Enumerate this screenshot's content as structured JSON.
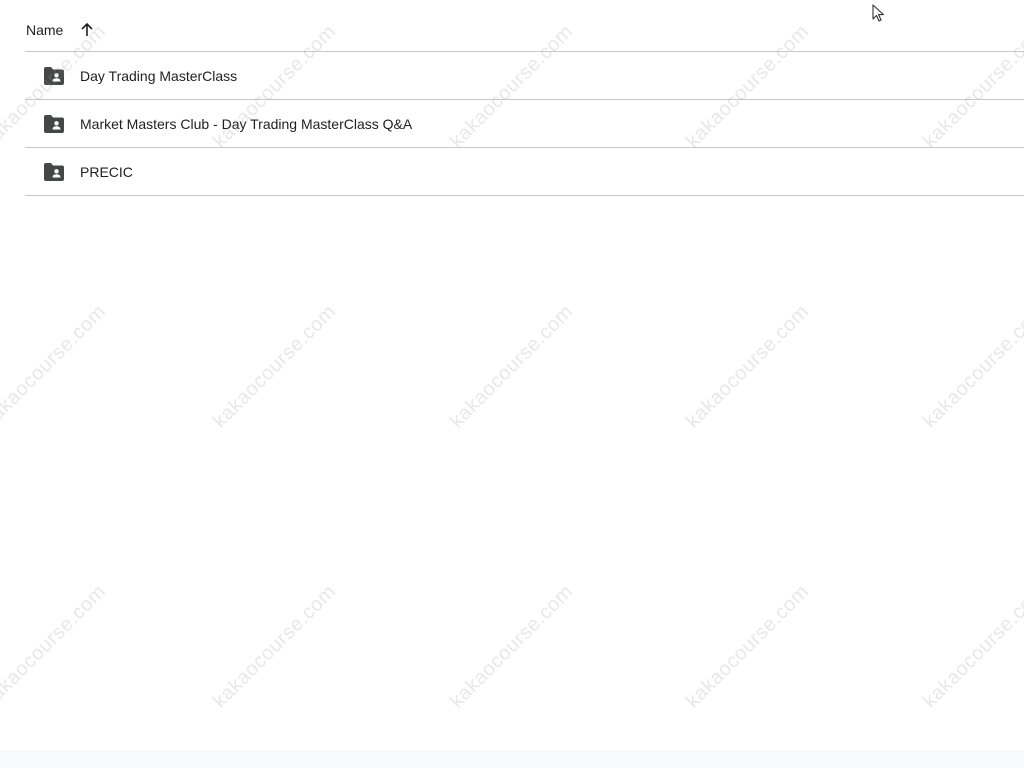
{
  "list_header": {
    "name_label": "Name",
    "sort_icon": "arrow-up-icon"
  },
  "folders": [
    {
      "label": "Day Trading MasterClass",
      "icon": "shared-folder-icon"
    },
    {
      "label": "Market Masters Club - Day Trading MasterClass Q&A",
      "icon": "shared-folder-icon"
    },
    {
      "label": "PRECIC",
      "icon": "shared-folder-icon"
    }
  ],
  "watermark_text": "kakaocourse.com",
  "colors": {
    "text": "#1f1f1f",
    "divider": "#c7c7c7",
    "icon": "#444746"
  }
}
